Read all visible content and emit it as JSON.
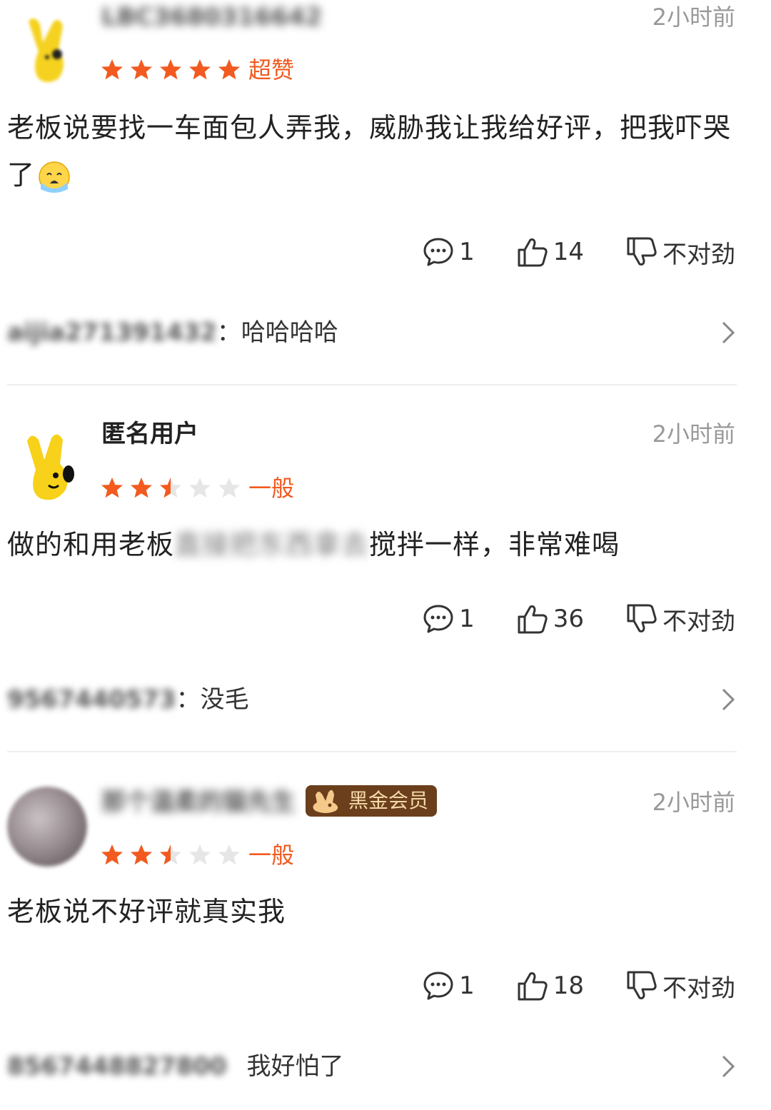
{
  "reviews": [
    {
      "username": "LBC3680316642",
      "badge": "",
      "time": "2小时前",
      "rating": 5,
      "rating_label": "超赞",
      "content": "老板说要找一车面包人弄我，威胁我让我给好评，把我吓哭了",
      "emoji": "crying-face",
      "comments": "1",
      "likes": "14",
      "dislike_label": "不对劲",
      "reply": {
        "name": "aijia271391432",
        "sep": "：",
        "text": "哈哈哈哈"
      }
    },
    {
      "username": "匿名用户",
      "time": "2小时前",
      "rating": 2.5,
      "rating_label": "一般",
      "content_a": "做的和用老板",
      "content_blur": "直接把东西拿去",
      "content_b": "搅拌一样，非常难喝",
      "comments": "1",
      "likes": "36",
      "dislike_label": "不对劲",
      "reply": {
        "name": "9567440573",
        "sep": "：",
        "text": "没毛"
      }
    },
    {
      "username": "那个温柔的猫先生",
      "badge": "黑金会员",
      "time": "2小时前",
      "rating": 2.5,
      "rating_label": "一般",
      "content": "老板说不好评就真实我",
      "comments": "1",
      "likes": "18",
      "dislike_label": "不对劲",
      "reply": {
        "name": "8567448827800",
        "sep": "",
        "text": "我好怕了"
      }
    }
  ],
  "colors": {
    "star_on": "#f25a1f",
    "star_off": "#e6e6e6",
    "accent": "#f25a1f",
    "badge_bg": "#6b3f1c"
  },
  "icons": [
    "comment-icon",
    "thumbs-up-icon",
    "thumbs-down-icon",
    "chevron-right-icon",
    "star-icon",
    "crying-face-emoji",
    "rabbit-badge-icon"
  ]
}
